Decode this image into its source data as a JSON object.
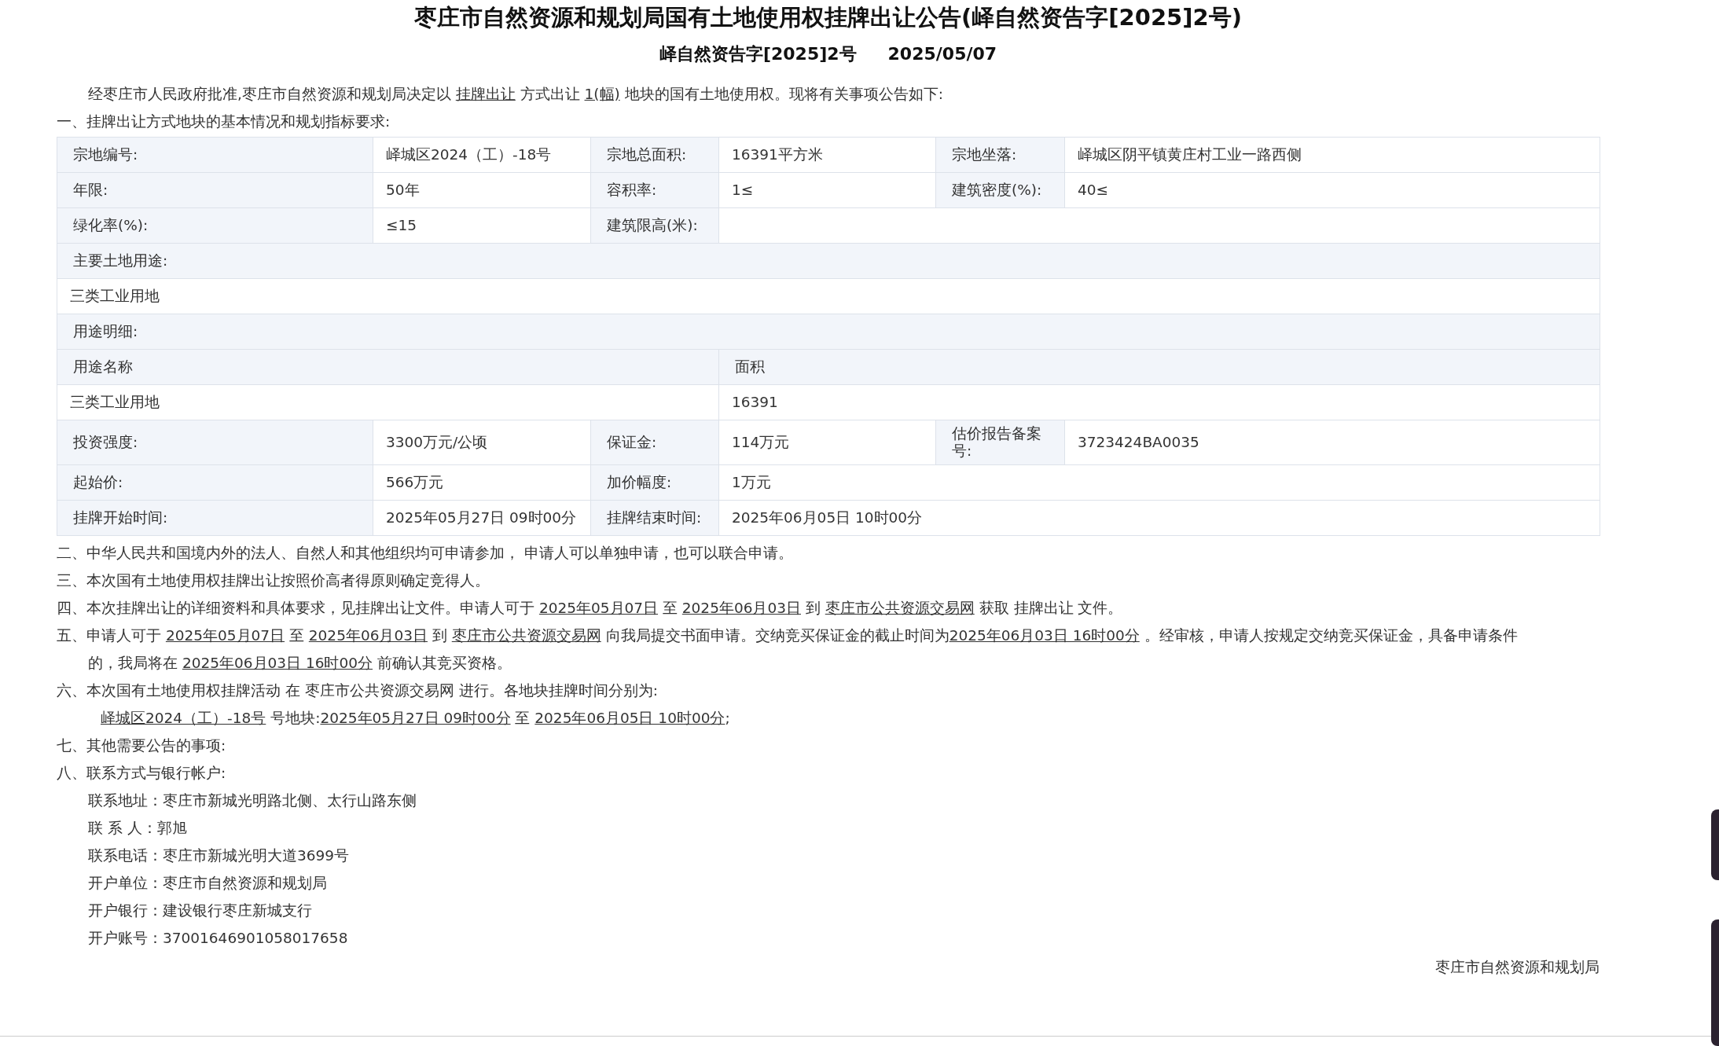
{
  "title": "枣庄市自然资源和规划局国有土地使用权挂牌出让公告(峄自然资告字[2025]2号)",
  "subtitle": {
    "doc_no": "峄自然资告字[2025]2号",
    "date": "2025/05/07"
  },
  "intro": [
    {
      "text": "经枣庄市人民政府批准,枣庄市自然资源和规划局决定以 "
    },
    {
      "text": "挂牌出让",
      "underline": true
    },
    {
      "text": " 方式出让 "
    },
    {
      "text": "1(幅)",
      "underline": true
    },
    {
      "text": " 地块的国有土地使用权。现将有关事项公告如下:"
    }
  ],
  "section_heading": "一、挂牌出让方式地块的基本情况和规划指标要求:",
  "table": {
    "rows": [
      {
        "kind": "fields",
        "cells": [
          {
            "label": "宗地编号:",
            "value": "峄城区2024（工）-18号"
          },
          {
            "label": "宗地总面积:",
            "value": "16391平方米"
          },
          {
            "label": "宗地坐落:",
            "value": "峄城区阴平镇黄庄村工业一路西侧"
          }
        ]
      },
      {
        "kind": "fields",
        "cells": [
          {
            "label": "年限:",
            "value": "50年"
          },
          {
            "label": "容积率:",
            "value": "1≤"
          },
          {
            "label": "建筑密度(%):",
            "value": "40≤"
          }
        ]
      },
      {
        "kind": "fields",
        "cells": [
          {
            "label": "绿化率(%):",
            "value": "≤15"
          },
          {
            "label": "建筑限高(米):"
          }
        ]
      },
      {
        "kind": "heading",
        "texts": [
          "主要土地用途:"
        ]
      },
      {
        "kind": "plain",
        "texts": [
          "三类工业用地"
        ]
      },
      {
        "kind": "heading",
        "texts": [
          "用途明细:"
        ]
      },
      {
        "kind": "heading",
        "texts": [
          "用途名称",
          "面积"
        ]
      },
      {
        "kind": "plain",
        "texts": [
          "三类工业用地",
          "16391"
        ]
      },
      {
        "kind": "fields",
        "cells": [
          {
            "label": "投资强度:",
            "value": "3300万元/公顷"
          },
          {
            "label": "保证金:",
            "value": "114万元"
          },
          {
            "label": "估价报告备案号:",
            "value": "3723424BA0035"
          }
        ]
      },
      {
        "kind": "fields",
        "cells": [
          {
            "label": "起始价:",
            "value": "566万元"
          },
          {
            "label": "加价幅度:",
            "value": "1万元"
          }
        ]
      },
      {
        "kind": "fields",
        "cells": [
          {
            "label": "挂牌开始时间:",
            "value": "2025年05月27日 09时00分"
          },
          {
            "label": "挂牌结束时间:",
            "value": "2025年06月05日 10时00分"
          }
        ]
      }
    ]
  },
  "items": [
    {
      "kind": "numbered",
      "segments": [
        {
          "text": "二、中华人民共和国境内外的法人、自然人和其他组织均可申请参加， 申请人可以单独申请，也可以联合申请。"
        }
      ]
    },
    {
      "kind": "numbered",
      "segments": [
        {
          "text": "三、本次国有土地使用权挂牌出让按照价高者得原则确定竞得人。"
        }
      ]
    },
    {
      "kind": "numbered",
      "segments": [
        {
          "text": "四、本次挂牌出让的详细资料和具体要求，见挂牌出让文件。申请人可于 "
        },
        {
          "text": "2025年05月07日",
          "underline": true
        },
        {
          "text": " 至 "
        },
        {
          "text": "2025年06月03日",
          "underline": true
        },
        {
          "text": " 到 "
        },
        {
          "text": "枣庄市公共资源交易网",
          "underline": true
        },
        {
          "text": " 获取 挂牌出让 文件。"
        }
      ]
    },
    {
      "kind": "numbered",
      "segments": [
        {
          "text": "五、申请人可于 "
        },
        {
          "text": "2025年05月07日",
          "underline": true
        },
        {
          "text": " 至 "
        },
        {
          "text": "2025年06月03日",
          "underline": true
        },
        {
          "text": " 到 "
        },
        {
          "text": "枣庄市公共资源交易网",
          "underline": true
        },
        {
          "text": " 向我局提交书面申请。交纳竞买保证金的截止时间为"
        },
        {
          "text": "2025年06月03日 16时00分",
          "underline": true
        },
        {
          "text": " 。经审核，申请人按规定交纳竞买保证金，具备申请条件的，我局将在 "
        },
        {
          "text": "2025年06月03日 16时00分",
          "underline": true
        },
        {
          "text": " 前确认其竞买资格。"
        }
      ]
    },
    {
      "kind": "numbered",
      "segments": [
        {
          "text": "六、本次国有土地使用权挂牌活动 在 枣庄市公共资源交易网 进行。各地块挂牌时间分别为:"
        }
      ]
    },
    {
      "kind": "detail",
      "segments": [
        {
          "text": "峄城区2024（工）-18号",
          "underline": true
        },
        {
          "text": " 号地块:"
        },
        {
          "text": "2025年05月27日 09时00分",
          "underline": true
        },
        {
          "text": " 至 "
        },
        {
          "text": "2025年06月05日 10时00分",
          "underline": true
        },
        {
          "text": ";"
        }
      ]
    },
    {
      "kind": "numbered",
      "segments": [
        {
          "text": "七、其他需要公告的事项:"
        }
      ]
    },
    {
      "kind": "numbered",
      "segments": [
        {
          "text": "八、联系方式与银行帐户:"
        }
      ]
    },
    {
      "kind": "contact",
      "segments": [
        {
          "text": "联系地址：枣庄市新城光明路北侧、太行山路东侧"
        }
      ]
    },
    {
      "kind": "contact",
      "segments": [
        {
          "text": "联 系 人：郭旭"
        }
      ]
    },
    {
      "kind": "contact",
      "segments": [
        {
          "text": "联系电话：枣庄市新城光明大道3699号"
        }
      ]
    },
    {
      "kind": "contact",
      "segments": [
        {
          "text": "开户单位：枣庄市自然资源和规划局"
        }
      ]
    },
    {
      "kind": "contact",
      "segments": [
        {
          "text": "开户银行：建设银行枣庄新城支行"
        }
      ]
    },
    {
      "kind": "contact",
      "segments": [
        {
          "text": "开户账号：37001646901058017658"
        }
      ]
    }
  ],
  "signature": "枣庄市自然资源和规划局"
}
